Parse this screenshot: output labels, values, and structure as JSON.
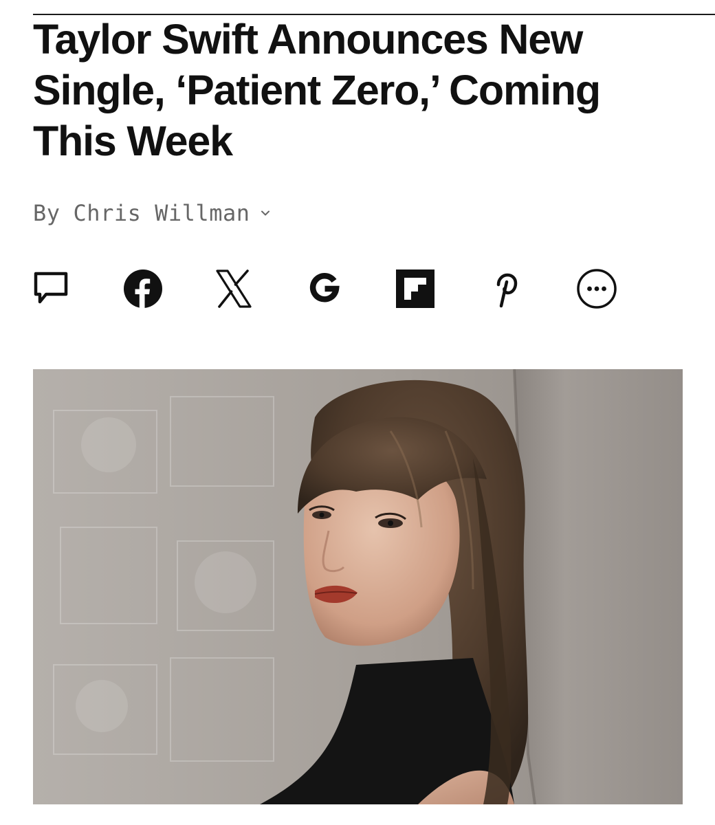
{
  "article": {
    "headline_lines": [
      "Taylor Swift Announces New",
      "Single, ‘Patient Zero,’ Coming",
      "This Week"
    ],
    "byline_prefix": "By",
    "author": "Chris Willman"
  },
  "share_icons": [
    "comment-icon",
    "facebook-icon",
    "x-icon",
    "google-icon",
    "flipboard-icon",
    "pinterest-icon",
    "more-icon"
  ],
  "colors": {
    "text": "#111111",
    "byline": "#666666"
  }
}
